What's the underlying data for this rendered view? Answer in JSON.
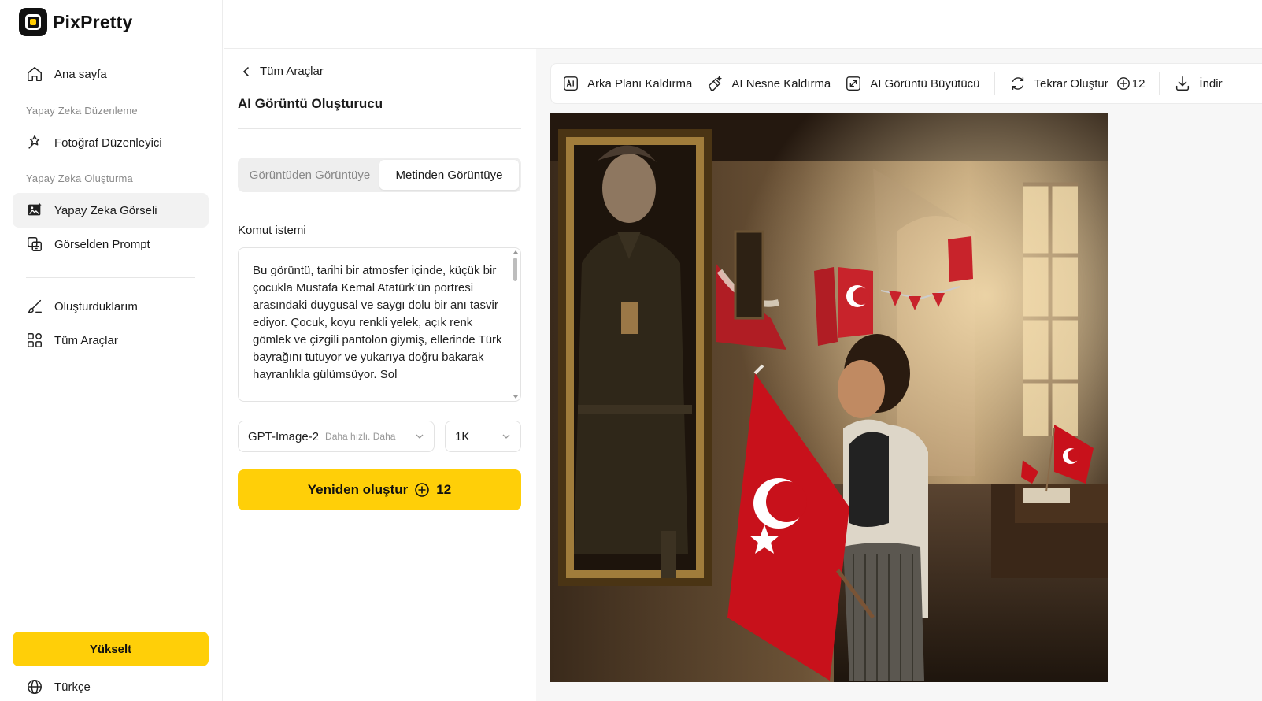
{
  "app": {
    "name": "PixPretty"
  },
  "sidebar": {
    "home": "Ana sayfa",
    "section_edit": "Yapay Zeka Düzenleme",
    "photo_editor": "Fotoğraf Düzenleyici",
    "section_create": "Yapay Zeka Oluşturma",
    "ai_image": "Yapay Zeka Görseli",
    "image_to_prompt": "Görselden Prompt",
    "my_creations": "Oluşturduklarım",
    "all_tools": "Tüm Araçlar",
    "upgrade": "Yükselt",
    "language": "Türkçe"
  },
  "panel": {
    "back_label": "Tüm Araçlar",
    "title": "AI Görüntü Oluşturucu",
    "tabs": [
      "Görüntüden Görüntüye",
      "Metinden Görüntüye"
    ],
    "active_tab": "Metinden Görüntüye",
    "prompt_label": "Komut istemi",
    "prompt_text": "Bu görüntü, tarihi bir atmosfer içinde, küçük bir çocukla Mustafa Kemal Atatürk’ün portresi arasındaki duygusal ve saygı dolu bir anı tasvir ediyor. Çocuk, koyu renkli yelek, açık renk gömlek ve çizgili pantolon giymiş, ellerinde Türk bayrağını tutuyor ve yukarıya doğru bakarak hayranlıkla gülümsüyor. Sol",
    "model": {
      "name": "GPT-Image-2",
      "hint": "Daha hızlı. Daha"
    },
    "resolution": "1K",
    "generate": {
      "label": "Yeniden oluştur",
      "cost": "12"
    }
  },
  "toolbar": {
    "remove_bg": "Arka Planı Kaldırma",
    "remove_object": "AI Nesne Kaldırma",
    "upscaler": "AI Görüntü Büyütücü",
    "regenerate": "Tekrar Oluştur",
    "regenerate_cost": "12",
    "download": "İndir"
  },
  "colors": {
    "accent": "#ffcf08",
    "text": "#1b1b1b",
    "muted": "#8a8a8a"
  }
}
